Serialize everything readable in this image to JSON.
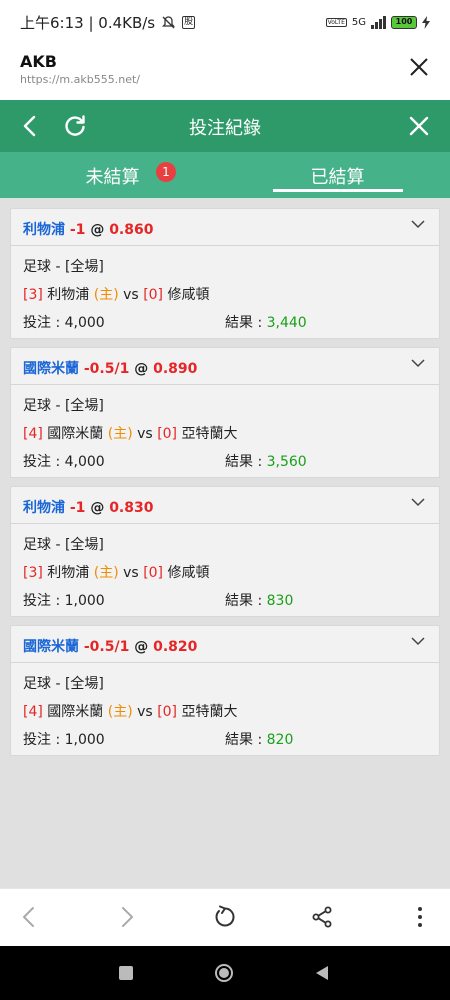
{
  "status_bar": {
    "time_speed": "上午6:13 | 0.4KB/s",
    "stock_icon_char": "股",
    "network_label": "5G",
    "volte_label": "VoLTE",
    "battery": "100"
  },
  "browser": {
    "site_title": "AKB",
    "url": "https://m.akb555.net/"
  },
  "header": {
    "title": "投注紀錄"
  },
  "tabs": [
    {
      "label": "未結算",
      "badge": "1"
    },
    {
      "label": "已結算"
    }
  ],
  "bets": [
    {
      "team": "利物浦",
      "handicap": "-1",
      "at": "@",
      "odds": "0.860",
      "sport": "足球 - [全場]",
      "home_score": "[3]",
      "home": "利物浦",
      "home_tag": "(主)",
      "vs": "vs",
      "away_score": "[0]",
      "away": "修咸頓",
      "stake_label": "投注 :",
      "stake": "4,000",
      "result_label": "結果 :",
      "result": "3,440"
    },
    {
      "team": "國際米蘭",
      "handicap": "-0.5/1",
      "at": "@",
      "odds": "0.890",
      "sport": "足球 - [全場]",
      "home_score": "[4]",
      "home": "國際米蘭",
      "home_tag": "(主)",
      "vs": "vs",
      "away_score": "[0]",
      "away": "亞特蘭大",
      "stake_label": "投注 :",
      "stake": "4,000",
      "result_label": "結果 :",
      "result": "3,560"
    },
    {
      "team": "利物浦",
      "handicap": "-1",
      "at": "@",
      "odds": "0.830",
      "sport": "足球 - [全場]",
      "home_score": "[3]",
      "home": "利物浦",
      "home_tag": "(主)",
      "vs": "vs",
      "away_score": "[0]",
      "away": "修咸頓",
      "stake_label": "投注 :",
      "stake": "1,000",
      "result_label": "結果 :",
      "result": "830"
    },
    {
      "team": "國際米蘭",
      "handicap": "-0.5/1",
      "at": "@",
      "odds": "0.820",
      "sport": "足球 - [全場]",
      "home_score": "[4]",
      "home": "國際米蘭",
      "home_tag": "(主)",
      "vs": "vs",
      "away_score": "[0]",
      "away": "亞特蘭大",
      "stake_label": "投注 :",
      "stake": "1,000",
      "result_label": "結果 :",
      "result": "820"
    }
  ],
  "colors": {
    "header_green": "#2e9a6a",
    "tab_green": "#46b28a",
    "team_blue": "#1a66d6",
    "odds_red": "#e52626",
    "home_orange": "#f08c00",
    "result_green": "#1aa01a"
  }
}
